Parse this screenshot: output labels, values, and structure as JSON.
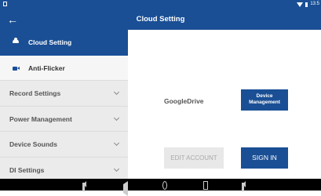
{
  "status_bar": {
    "time": "13:5"
  },
  "header": {
    "title": "Cloud Setting",
    "back_icon": "arrow-left-icon"
  },
  "sidebar": {
    "items": [
      {
        "label": "Cloud Setting",
        "icon": "cloud-icon",
        "state": "active"
      },
      {
        "label": "Anti-Flicker",
        "icon": "video-camera-icon"
      },
      {
        "label": "Record Settings",
        "icon": "chevron-down-icon"
      },
      {
        "label": "Power Management",
        "icon": "chevron-down-icon"
      },
      {
        "label": "Device Sounds",
        "icon": "chevron-down-icon"
      },
      {
        "label": "DI Settings",
        "icon": "chevron-down-icon"
      }
    ]
  },
  "main": {
    "service_label": "GoogleDrive",
    "device_management_line1": "Device",
    "device_management_line2": "Management",
    "edit_account_label": "EDIT ACCOUNT",
    "sign_in_label": "SIGN IN"
  },
  "colors": {
    "accent": "#1a4f95",
    "sidebar_bg": "#ebebeb",
    "disabled_button": "#e8e8e8"
  },
  "nav_bar": {
    "icons": [
      "volume-down-icon",
      "back-icon",
      "home-icon",
      "recent-apps-icon",
      "volume-up-icon"
    ]
  }
}
